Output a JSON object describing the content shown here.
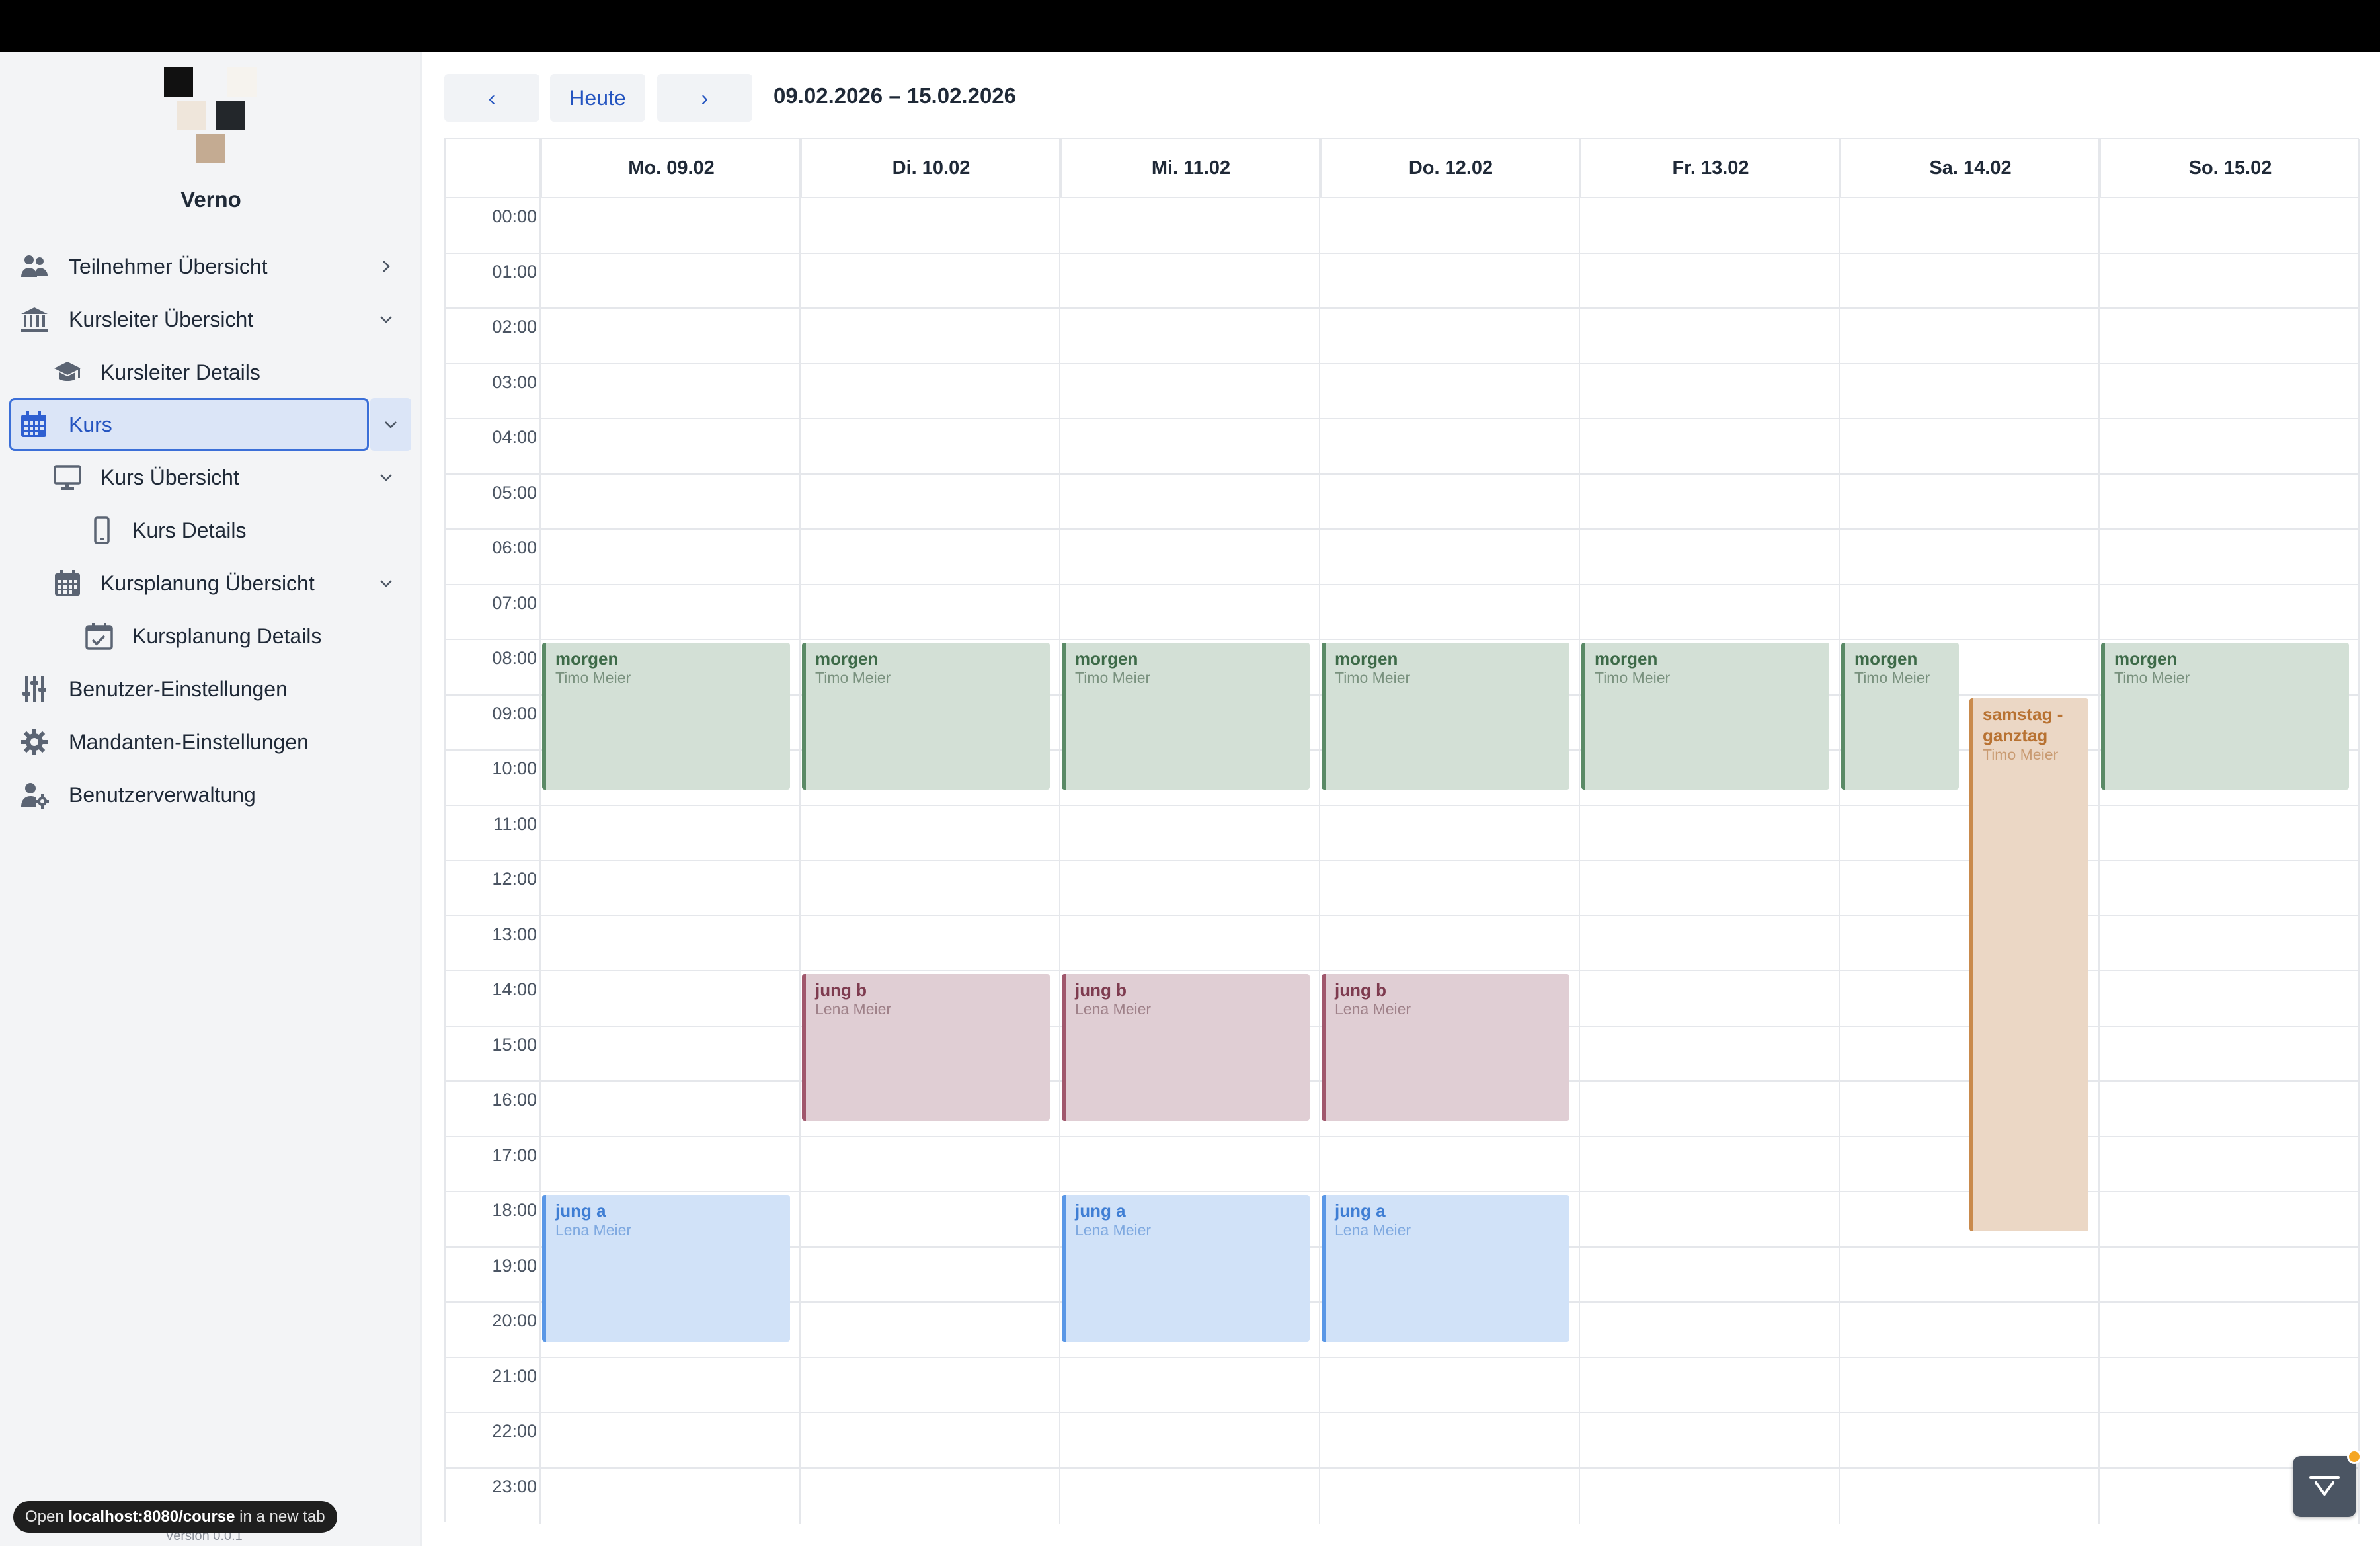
{
  "app": {
    "brand": "Verno"
  },
  "sidebar": {
    "items": [
      {
        "label": "Teilnehmer Übersicht"
      },
      {
        "label": "Kursleiter Übersicht"
      },
      {
        "label": "Kursleiter Details"
      },
      {
        "label": "Kurs"
      },
      {
        "label": "Kurs Übersicht"
      },
      {
        "label": "Kurs Details"
      },
      {
        "label": "Kursplanung Übersicht"
      },
      {
        "label": "Kursplanung Details"
      },
      {
        "label": "Benutzer-Einstellungen"
      },
      {
        "label": "Mandanten-Einstellungen"
      },
      {
        "label": "Benutzerverwaltung"
      }
    ],
    "active": "Kurs",
    "version": "Version 0.0.1"
  },
  "tooltip": {
    "prefix": "Open",
    "url": "localhost:8080/course",
    "suffix": "in a new tab"
  },
  "toolbar": {
    "prev": "‹",
    "today": "Heute",
    "next": "›",
    "range": "09.02.2026 – 15.02.2026"
  },
  "calendar": {
    "days": [
      "Mo. 09.02",
      "Di. 10.02",
      "Mi. 11.02",
      "Do. 12.02",
      "Fr. 13.02",
      "Sa. 14.02",
      "So. 15.02"
    ],
    "hours": [
      "00:00",
      "01:00",
      "02:00",
      "03:00",
      "04:00",
      "05:00",
      "06:00",
      "07:00",
      "08:00",
      "09:00",
      "10:00",
      "11:00",
      "12:00",
      "13:00",
      "14:00",
      "15:00",
      "16:00",
      "17:00",
      "18:00",
      "19:00",
      "20:00",
      "21:00",
      "22:00",
      "23:00"
    ],
    "events": [
      {
        "day": 0,
        "start": 8,
        "end": 10.8,
        "title": "morgen",
        "person": "Timo Meier",
        "color": "green"
      },
      {
        "day": 1,
        "start": 8,
        "end": 10.8,
        "title": "morgen",
        "person": "Timo Meier",
        "color": "green"
      },
      {
        "day": 2,
        "start": 8,
        "end": 10.8,
        "title": "morgen",
        "person": "Timo Meier",
        "color": "green"
      },
      {
        "day": 3,
        "start": 8,
        "end": 10.8,
        "title": "morgen",
        "person": "Timo Meier",
        "color": "green"
      },
      {
        "day": 4,
        "start": 8,
        "end": 10.8,
        "title": "morgen",
        "person": "Timo Meier",
        "color": "green"
      },
      {
        "day": 5,
        "start": 8,
        "end": 10.8,
        "title": "morgen",
        "person": "Timo Meier",
        "color": "green",
        "lane": "left"
      },
      {
        "day": 6,
        "start": 8,
        "end": 10.8,
        "title": "morgen",
        "person": "Timo Meier",
        "color": "green"
      },
      {
        "day": 5,
        "start": 9,
        "end": 18.8,
        "title": "samstag - ganztag",
        "person": "Timo Meier",
        "color": "orange",
        "lane": "right"
      },
      {
        "day": 1,
        "start": 14,
        "end": 16.8,
        "title": "jung b",
        "person": "Lena Meier",
        "color": "red"
      },
      {
        "day": 2,
        "start": 14,
        "end": 16.8,
        "title": "jung b",
        "person": "Lena Meier",
        "color": "red"
      },
      {
        "day": 3,
        "start": 14,
        "end": 16.8,
        "title": "jung b",
        "person": "Lena Meier",
        "color": "red"
      },
      {
        "day": 0,
        "start": 18,
        "end": 20.8,
        "title": "jung a",
        "person": "Lena Meier",
        "color": "blue"
      },
      {
        "day": 2,
        "start": 18,
        "end": 20.8,
        "title": "jung a",
        "person": "Lena Meier",
        "color": "blue"
      },
      {
        "day": 3,
        "start": 18,
        "end": 20.8,
        "title": "jung a",
        "person": "Lena Meier",
        "color": "blue"
      }
    ]
  },
  "colors": {
    "accent": "#2454c0",
    "topbar": "#000000",
    "sidebar_bg": "#f3f4f6"
  }
}
